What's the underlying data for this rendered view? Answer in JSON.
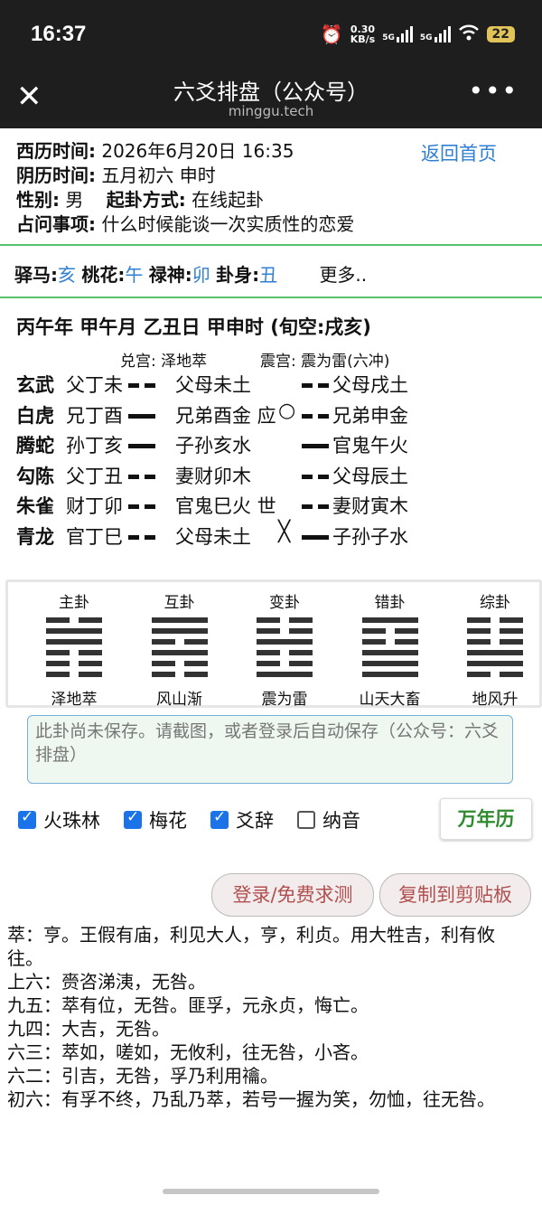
{
  "status": {
    "time": "16:37",
    "net_speed": "0.30",
    "net_unit": "KB/s",
    "sig1": "5G",
    "sig2": "5G",
    "battery": "22"
  },
  "header": {
    "title": "六爻排盘（公众号）",
    "subtitle": "minggu.tech"
  },
  "info": {
    "solar_label": "西历时间:",
    "solar_value": "2026年6月20日 16:35",
    "lunar_label": "阴历时间:",
    "lunar_value": "五月初六 申时",
    "gender_label": "性别:",
    "gender_value": "男",
    "method_label": "起卦方式:",
    "method_value": "在线起卦",
    "question_label": "占问事项:",
    "question_value": "什么时候能谈一次实质性的恋爱",
    "home_link": "返回首页"
  },
  "tags": {
    "yima_label": "驿马:",
    "yima": "亥",
    "taohua_label": "桃花:",
    "taohua": "午",
    "lushen_label": "禄神:",
    "lushen": "卯",
    "guashen_label": "卦身:",
    "guashen": "丑",
    "more": "更多.."
  },
  "ganzhi": "丙午年 甲午月 乙丑日 甲申时 (旬空:戌亥)",
  "gong_ben": "兑宫:  泽地萃",
  "gong_bian": "震宫:  震为雷(六冲)",
  "lines": [
    {
      "god": "玄武",
      "hidden": "父丁未",
      "ben_yao": "yin",
      "ben": "父母未土",
      "mark": "",
      "bian_yao": "yin",
      "bian": "父母戌土"
    },
    {
      "god": "白虎",
      "hidden": "兄丁酉",
      "ben_yao": "yang",
      "ben": "兄弟酉金 应",
      "mark": "○",
      "bian_yao": "yin",
      "bian": "兄弟申金"
    },
    {
      "god": "腾蛇",
      "hidden": "孙丁亥",
      "ben_yao": "yang",
      "ben": "子孙亥水",
      "mark": "",
      "bian_yao": "yang",
      "bian": "官鬼午火"
    },
    {
      "god": "勾陈",
      "hidden": "父丁丑",
      "ben_yao": "yin",
      "ben": "妻财卯木",
      "mark": "",
      "bian_yao": "yin",
      "bian": "父母辰土"
    },
    {
      "god": "朱雀",
      "hidden": "财丁卯",
      "ben_yao": "yin",
      "ben": "官鬼巳火 世",
      "mark": "",
      "bian_yao": "yin",
      "bian": "妻财寅木"
    },
    {
      "god": "青龙",
      "hidden": "官丁巳",
      "ben_yao": "yin",
      "ben": "父母未土",
      "mark": "╳",
      "bian_yao": "yang",
      "bian": "子孙子水"
    }
  ],
  "guas": [
    {
      "label": "主卦",
      "name": "泽地萃",
      "lines": [
        "yin",
        "yang",
        "yang",
        "yin",
        "yin",
        "yin"
      ]
    },
    {
      "label": "互卦",
      "name": "风山渐",
      "lines": [
        "yang",
        "yang",
        "yin",
        "yang",
        "yin",
        "yin"
      ]
    },
    {
      "label": "变卦",
      "name": "震为雷",
      "lines": [
        "yin",
        "yin",
        "yang",
        "yin",
        "yin",
        "yang"
      ]
    },
    {
      "label": "错卦",
      "name": "山天大畜",
      "lines": [
        "yang",
        "yin",
        "yin",
        "yang",
        "yang",
        "yang"
      ]
    },
    {
      "label": "综卦",
      "name": "地风升",
      "lines": [
        "yin",
        "yin",
        "yin",
        "yang",
        "yang",
        "yin"
      ]
    }
  ],
  "note": "此卦尚未保存。请截图，或者登录后自动保存（公众号：六爻排盘）",
  "checks": [
    {
      "label": "火珠林",
      "checked": true
    },
    {
      "label": "梅花",
      "checked": true
    },
    {
      "label": "爻辞",
      "checked": true
    },
    {
      "label": "纳音",
      "checked": false
    }
  ],
  "calendar_button": "万年历",
  "login_button": "登录/免费求测",
  "copy_button": "复制到剪贴板",
  "texts": [
    "萃：亨。王假有庙，利见大人，亨，利贞。用大牲吉，利有攸往。",
    "上六：赍咨涕洟，无咎。",
    "九五：萃有位，无咎。匪孚，元永贞，悔亡。",
    "九四：大吉，无咎。",
    "六三：萃如，嗟如，无攸利，往无咎，小吝。",
    "六二：引吉，无咎，孚乃利用禴。",
    "初六：有孚不终，乃乱乃萃，若号一握为笑，勿恤，往无咎。"
  ]
}
